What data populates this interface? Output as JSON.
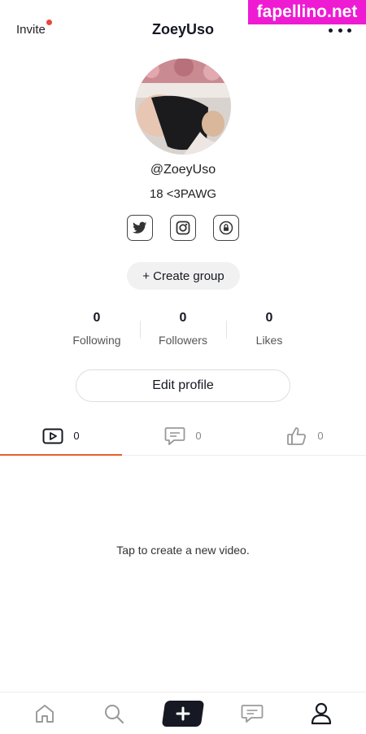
{
  "header": {
    "invite_label": "Invite",
    "title": "ZoeyUso",
    "watermark": "fapellino.net"
  },
  "profile": {
    "handle": "@ZoeyUso",
    "bio": "18 <3PAWG",
    "socials": [
      "twitter-icon",
      "instagram-icon",
      "lock-link-icon"
    ],
    "create_group_label": "+ Create group"
  },
  "stats": [
    {
      "value": "0",
      "label": "Following"
    },
    {
      "value": "0",
      "label": "Followers"
    },
    {
      "value": "0",
      "label": "Likes"
    }
  ],
  "edit_profile_label": "Edit profile",
  "tabs": [
    {
      "icon": "video-icon",
      "count": "0",
      "active": true
    },
    {
      "icon": "comment-icon",
      "count": "0",
      "active": false
    },
    {
      "icon": "thumbs-up-icon",
      "count": "0",
      "active": false
    }
  ],
  "empty_state": "Tap to create a new video.",
  "bottom_nav": [
    "home-icon",
    "search-icon",
    "create-icon",
    "messages-icon",
    "profile-icon"
  ],
  "colors": {
    "accent": "#e8602c",
    "notification_dot": "#e8473f",
    "watermark_bg": "#ee1bd3",
    "text_primary": "#161823"
  }
}
